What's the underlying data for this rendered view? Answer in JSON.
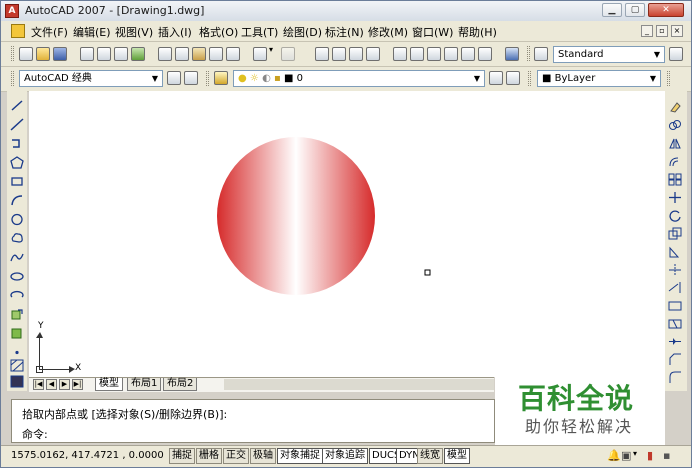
{
  "window": {
    "title": "AutoCAD 2007 - [Drawing1.dwg]",
    "controls": {
      "minimize": "▁",
      "restore": "▢",
      "close": "✕"
    }
  },
  "menu": {
    "items": [
      "文件(F)",
      "编辑(E)",
      "视图(V)",
      "插入(I)",
      "格式(O)",
      "工具(T)",
      "绘图(D)",
      "标注(N)",
      "修改(M)",
      "窗口(W)",
      "帮助(H)"
    ],
    "mdi_controls": [
      "_",
      "▫",
      "×"
    ]
  },
  "toolbars": {
    "text_style": "Standard",
    "workspace": "AutoCAD 经典",
    "layer": "0",
    "color": "ByLayer"
  },
  "canvas": {
    "ucs_x": "X",
    "ucs_y": "Y",
    "colors": {
      "hatch_red": "#d62b2b",
      "hatch_white": "#ffffff"
    }
  },
  "layout_tabs": {
    "nav": [
      "|◀",
      "◀",
      "▶",
      "▶|"
    ],
    "tabs": [
      "模型",
      "布局1",
      "布局2"
    ],
    "active": "模型"
  },
  "command": {
    "line1": "拾取内部点或 [选择对象(S)/删除边界(B)]:",
    "line2": "命令:"
  },
  "watermark": {
    "main": "百科全说",
    "sub": "助你轻松解决"
  },
  "status": {
    "coords": "1575.0162, 417.4721 , 0.0000",
    "buttons": [
      "捕捉",
      "栅格",
      "正交",
      "极轴",
      "对象捕捉",
      "对象追踪",
      "DUCS",
      "DYN",
      "线宽",
      "模型"
    ]
  }
}
